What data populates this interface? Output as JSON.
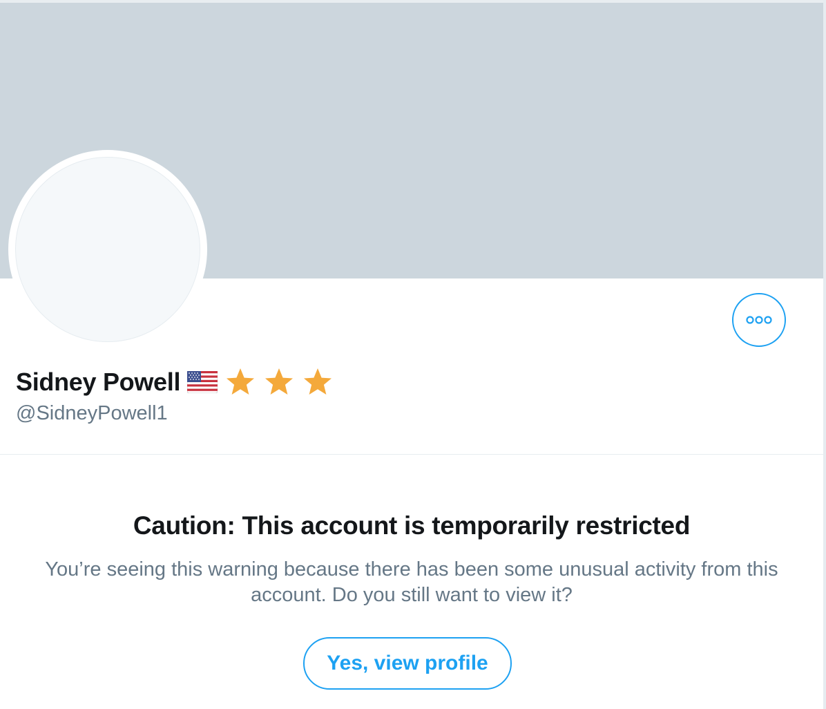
{
  "profile": {
    "display_name": "Sidney Powell",
    "handle": "@SidneyPowell1",
    "badges": [
      "us-flag-icon",
      "star-icon",
      "star-icon",
      "star-icon"
    ]
  },
  "warning": {
    "title": "Caution: This account is temporarily restricted",
    "body": "You’re seeing this warning because there has been some unusual activity from this account. Do you still want to view it?",
    "button_label": "Yes, view profile"
  },
  "colors": {
    "banner": "#ccd6dd",
    "accent": "#1da1f2",
    "star": "#f4a93b",
    "secondary_text": "#657786",
    "primary_text": "#14171a"
  }
}
